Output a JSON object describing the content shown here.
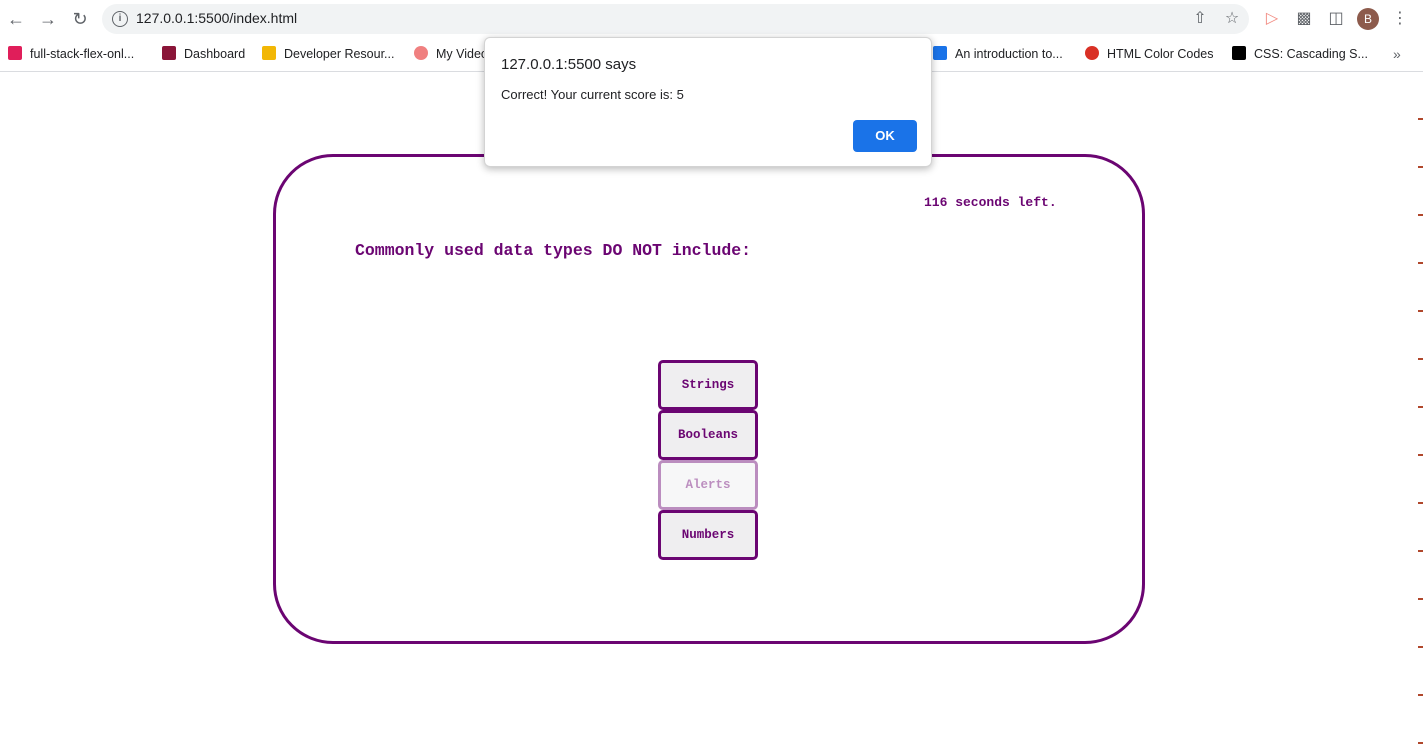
{
  "browser": {
    "url": "127.0.0.1:5500/index.html",
    "avatar_letter": "B",
    "icons": [
      "back-icon",
      "forward-icon",
      "reload-icon",
      "info-icon",
      "share-icon",
      "star-icon",
      "extension-record-icon",
      "puzzle-icon",
      "side-panel-icon",
      "kebab-menu-icon"
    ],
    "bookmarks": [
      {
        "label": "full-stack-flex-onl...",
        "icon": "slack-icon",
        "color": "#e01e5a"
      },
      {
        "label": "Dashboard",
        "icon": "shield-icon",
        "color": "#8a1538"
      },
      {
        "label": "Developer Resour...",
        "icon": "fs-icon",
        "color": "#f2b705"
      },
      {
        "label": "My Video",
        "icon": "arrow-icon",
        "color": "#f08080"
      },
      {
        "label": "An introduction to...",
        "icon": "play-icon",
        "color": "#1a73e8"
      },
      {
        "label": "HTML Color Codes",
        "icon": "circle-icon",
        "color": "#d93025"
      },
      {
        "label": "CSS: Cascading S...",
        "icon": "mdn-icon",
        "color": "#000000"
      }
    ],
    "overflow_label": "»"
  },
  "quiz": {
    "timer_text": "116 seconds left.",
    "question": "Commonly used data types DO NOT include:",
    "answers": [
      "Strings",
      "Booleans",
      "Alerts",
      "Numbers"
    ],
    "accent_color": "#6b0572"
  },
  "dialog": {
    "title": "127.0.0.1:5500 says",
    "message": "Correct! Your current score is: 5",
    "ok_label": "OK",
    "ok_color": "#1a73e8"
  }
}
